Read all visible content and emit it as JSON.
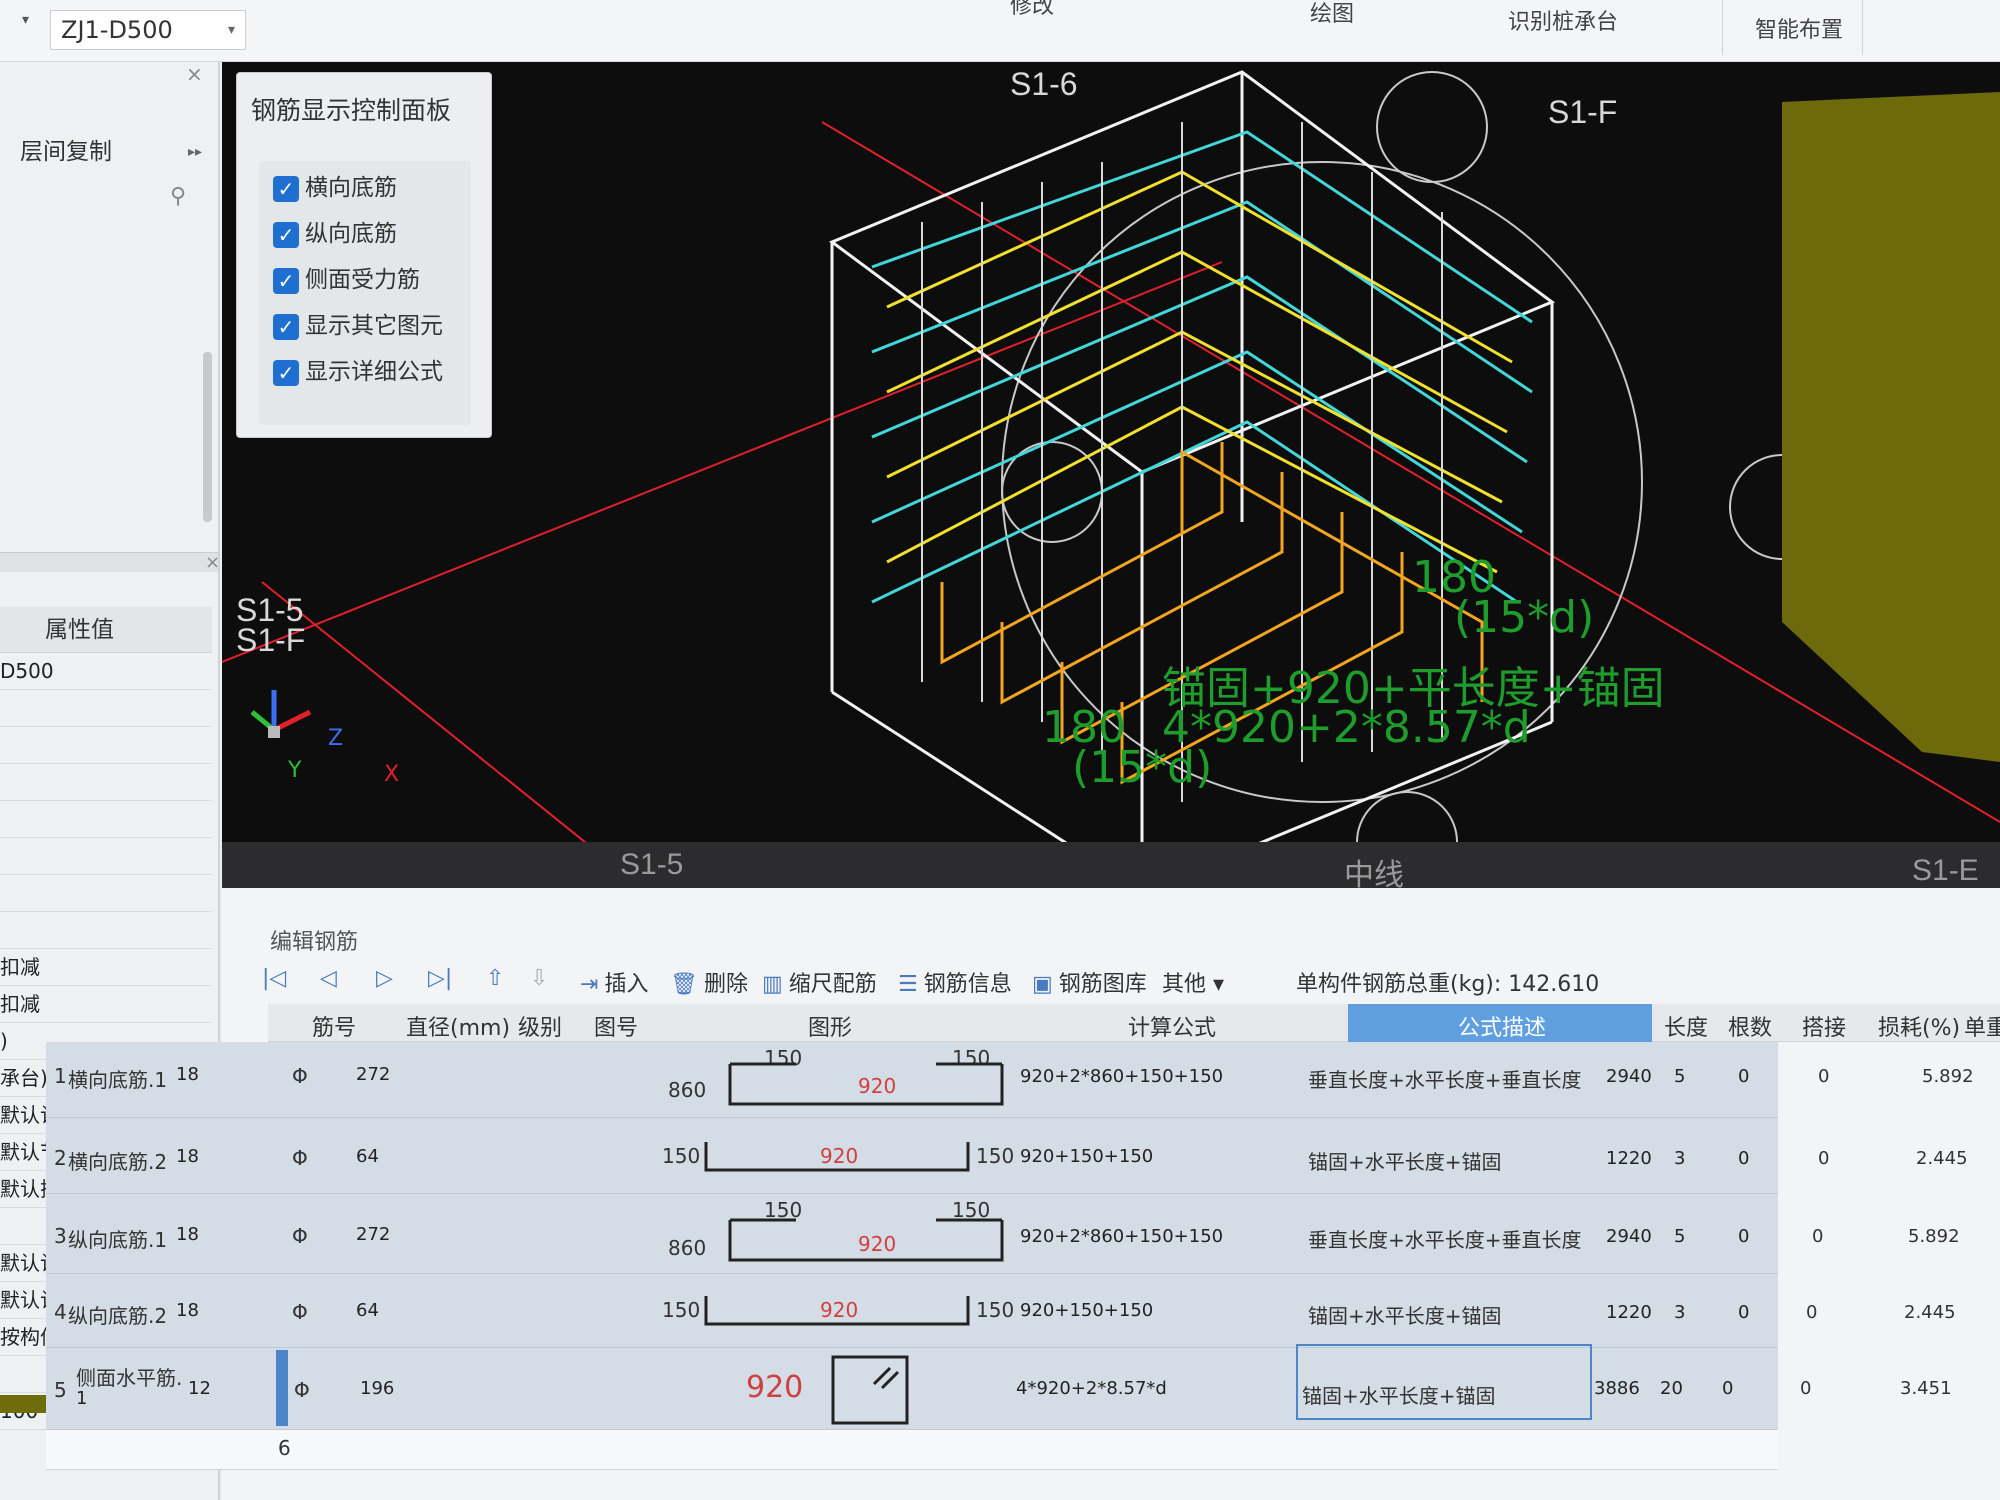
{
  "topbar": {
    "component": "ZJ1-D500",
    "tabs": [
      "修改",
      "绘图",
      "识别桩承台",
      "智能布置"
    ]
  },
  "left_panel": {
    "floor_copy": "层间复制",
    "property_header": "属性值",
    "rows": [
      {
        "label": "D500"
      },
      {
        "label": ""
      },
      {
        "label": ""
      },
      {
        "label": ""
      },
      {
        "label": ""
      },
      {
        "label": ""
      },
      {
        "label": ""
      },
      {
        "label": ""
      },
      {
        "label": "扣减"
      },
      {
        "label": "扣减"
      },
      {
        "label": ")"
      },
      {
        "label": "承台)"
      },
      {
        "label": "默认计算设置计算"
      },
      {
        "label": "默认节点设置计算"
      },
      {
        "label": "默认搭接设置计算"
      },
      {
        "label": ""
      },
      {
        "label": "默认计算设置"
      },
      {
        "label": "默认计算规则"
      },
      {
        "label": "按构件做法"
      },
      {
        "label": ""
      },
      {
        "label": "100"
      }
    ]
  },
  "control_panel": {
    "title": "钢筋显示控制面板",
    "items": [
      {
        "label": "横向底筋",
        "checked": true
      },
      {
        "label": "纵向底筋",
        "checked": true
      },
      {
        "label": "侧面受力筋",
        "checked": true
      },
      {
        "label": "显示其它图元",
        "checked": true
      },
      {
        "label": "显示详细公式",
        "checked": true
      }
    ]
  },
  "viewport": {
    "labels": {
      "s16": "S1-6",
      "s1f_top": "S1-F",
      "s15_left": "S1-5",
      "s1f_left": "S1-F",
      "s15_bottom": "S1-5",
      "s1e_bottom": "S1-E",
      "mid": "中线"
    },
    "annotations": {
      "a1": "180",
      "a2": "(15*d)",
      "a3": "锚固+920+平长度+锚固",
      "a4": "180",
      "a5": "4*920+2*8.57*d",
      "a6": "(15*d)"
    },
    "axis": {
      "x": "X",
      "y": "Y",
      "z": "Z"
    }
  },
  "editor": {
    "title": "编辑钢筋",
    "toolbar": {
      "insert": "插入",
      "delete": "删除",
      "scale": "缩尺配筋",
      "info": "钢筋信息",
      "library": "钢筋图库",
      "other": "其他",
      "weight_label": "单构件钢筋总重(kg):",
      "weight_value": "142.610"
    },
    "columns": [
      "筋号",
      "直径(mm)",
      "级别",
      "图号",
      "图形",
      "计算公式",
      "公式描述",
      "长度",
      "根数",
      "搭接",
      "损耗(%)",
      "单重(kg"
    ],
    "rows": [
      {
        "no": "1",
        "name": "横向底筋.1",
        "dia": "18",
        "grade": "Φ",
        "fig": "272",
        "left": "860",
        "top_l": "150",
        "top_r": "150",
        "mid": "920",
        "formula": "920+2*860+150+150",
        "desc": "垂直长度+水平长度+垂直长度",
        "len": "2940",
        "count": "5",
        "lap": "0",
        "loss": "0",
        "weight": "5.892"
      },
      {
        "no": "2",
        "name": "横向底筋.2",
        "dia": "18",
        "grade": "Φ",
        "fig": "64",
        "left": "150",
        "right": "150",
        "mid": "920",
        "formula": "920+150+150",
        "desc": "锚固+水平长度+锚固",
        "len": "1220",
        "count": "3",
        "lap": "0",
        "loss": "0",
        "weight": "2.445"
      },
      {
        "no": "3",
        "name": "纵向底筋.1",
        "dia": "18",
        "grade": "Φ",
        "fig": "272",
        "left": "860",
        "top_l": "150",
        "top_r": "150",
        "mid": "920",
        "formula": "920+2*860+150+150",
        "desc": "垂直长度+水平长度+垂直长度",
        "len": "2940",
        "count": "5",
        "lap": "0",
        "loss": "0",
        "weight": "5.892"
      },
      {
        "no": "4",
        "name": "纵向底筋.2",
        "dia": "18",
        "grade": "Φ",
        "fig": "64",
        "left": "150",
        "right": "150",
        "mid": "920",
        "formula": "920+150+150",
        "desc": "锚固+水平长度+锚固",
        "len": "1220",
        "count": "3",
        "lap": "0",
        "loss": "0",
        "weight": "2.445"
      },
      {
        "no": "5",
        "name": "侧面水平筋.",
        "name2": "1",
        "dia": "12",
        "grade": "Φ",
        "fig": "196",
        "mid": "920",
        "formula": "4*920+2*8.57*d",
        "desc": "锚固+水平长度+锚固",
        "len": "3886",
        "count": "20",
        "lap": "0",
        "loss": "0",
        "weight": "3.451"
      }
    ],
    "row6": "6"
  },
  "colors": {
    "viewport_bg": "#0d0d0e",
    "cyan_bar": "#43d6d8",
    "yellow_bar": "#f2e02e",
    "orange_bar": "#f3a51f",
    "green_text": "#1f9d2c",
    "red_axis": "#e0202a",
    "checkbox": "#1e6fd0",
    "desc_header": "#5f9fe0"
  }
}
